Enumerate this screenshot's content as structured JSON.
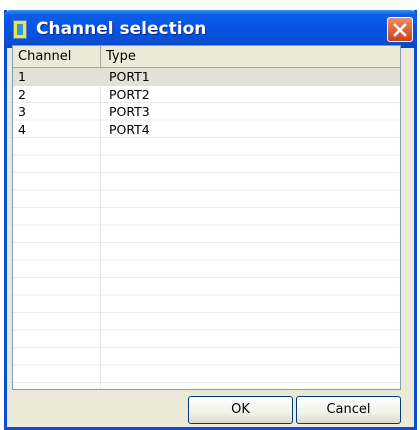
{
  "window": {
    "title": "Channel selection",
    "app_icon": "app-icon",
    "close_icon": "close-icon"
  },
  "list": {
    "columns": [
      "Channel",
      "Type"
    ],
    "rows": [
      {
        "channel": "1",
        "type": "PORT1",
        "selected": true
      },
      {
        "channel": "2",
        "type": "PORT2",
        "selected": false
      },
      {
        "channel": "3",
        "type": "PORT3",
        "selected": false
      },
      {
        "channel": "4",
        "type": "PORT4",
        "selected": false
      }
    ]
  },
  "buttons": {
    "ok": "OK",
    "cancel": "Cancel"
  },
  "colors": {
    "titlebar": "#0554e3",
    "close": "#e06338",
    "selection": "#e3e1d6"
  }
}
